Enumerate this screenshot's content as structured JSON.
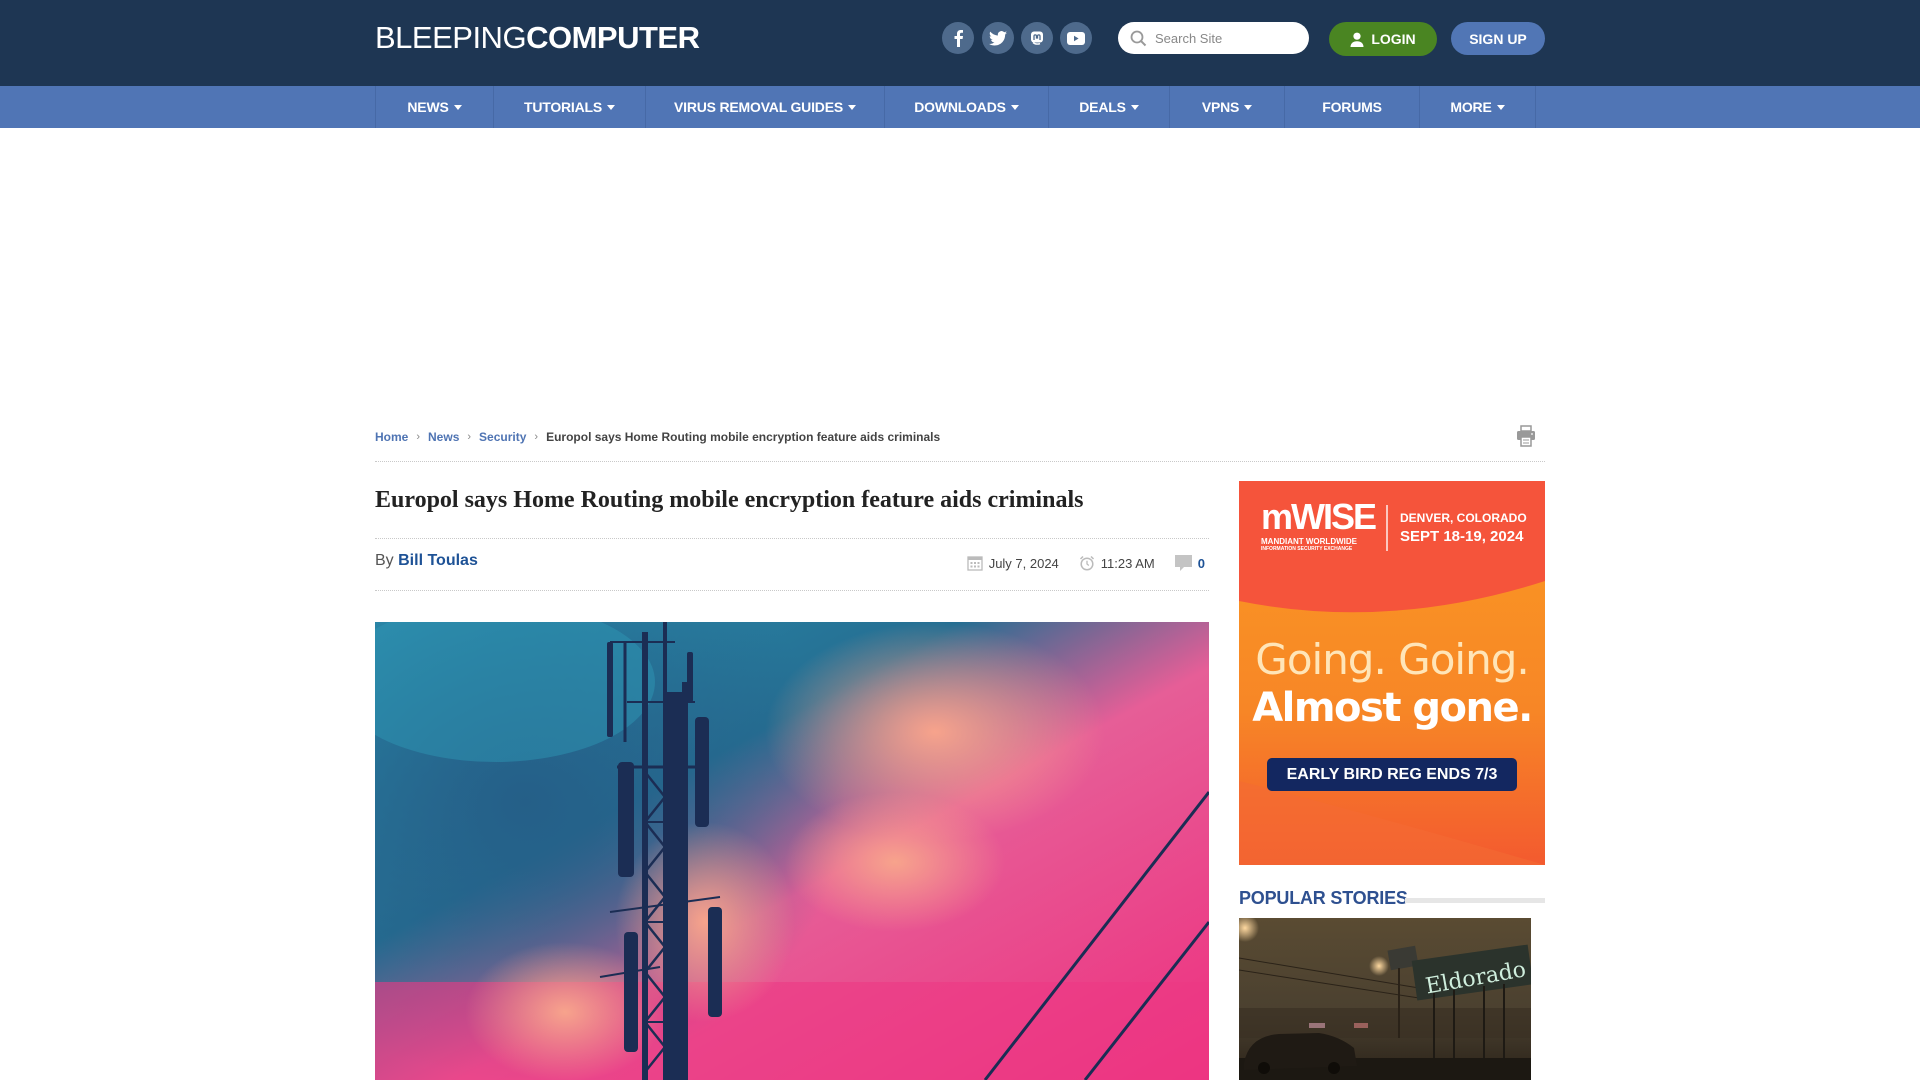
{
  "header": {
    "logo_light": "BLEEPING",
    "logo_bold": "COMPUTER",
    "social": [
      {
        "name": "facebook",
        "icon": "facebook-icon"
      },
      {
        "name": "twitter",
        "icon": "twitter-icon"
      },
      {
        "name": "mastodon",
        "icon": "mastodon-icon"
      },
      {
        "name": "youtube",
        "icon": "youtube-icon"
      }
    ],
    "search_placeholder": "Search Site",
    "search_value": "",
    "login_label": "LOGIN",
    "signup_label": "SIGN UP"
  },
  "nav": {
    "items": [
      {
        "label": "NEWS",
        "dropdown": true
      },
      {
        "label": "TUTORIALS",
        "dropdown": true
      },
      {
        "label": "VIRUS REMOVAL GUIDES",
        "dropdown": true
      },
      {
        "label": "DOWNLOADS",
        "dropdown": true
      },
      {
        "label": "DEALS",
        "dropdown": true
      },
      {
        "label": "VPNS",
        "dropdown": true
      },
      {
        "label": "FORUMS",
        "dropdown": false
      },
      {
        "label": "MORE",
        "dropdown": true
      }
    ]
  },
  "breadcrumb": {
    "items": [
      "Home",
      "News",
      "Security"
    ],
    "current": "Europol says Home Routing mobile encryption feature aids criminals"
  },
  "article": {
    "title": "Europol says Home Routing mobile encryption feature aids criminals",
    "by_label": "By",
    "author": "Bill Toulas",
    "date": "July 7, 2024",
    "time": "11:23 AM",
    "comments": "0"
  },
  "ad": {
    "brand": "mWISE",
    "brand_sub1": "MANDIANT WORLDWIDE",
    "brand_sub2": "INFORMATION SECURITY EXCHANGE",
    "location": "DENVER, COLORADO",
    "dates": "SEPT 18-19, 2024",
    "headline1": "Going. Going.",
    "headline2": "Almost gone.",
    "cta": "EARLY BIRD REG ENDS 7/3"
  },
  "sidebar": {
    "popular_heading": "POPULAR STORIES",
    "popular_image_sign": "Eldorado"
  },
  "colors": {
    "header_bg": "#1e3653",
    "nav_bg": "#5075b5",
    "login_green": "#4a8522",
    "signup_blue": "#5176b5",
    "link_blue": "#1e5296"
  }
}
